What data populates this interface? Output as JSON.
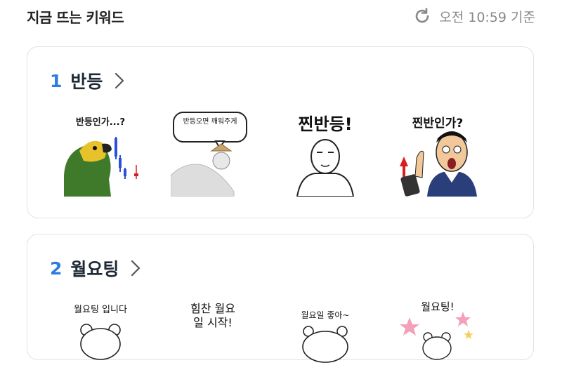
{
  "header": {
    "title": "지금 뜨는 키워드",
    "updated": "오전 10:59 기준",
    "refresh_icon": "refresh-icon"
  },
  "keywords": [
    {
      "rank": "1",
      "keyword": "반등",
      "stickers": [
        {
          "caption": "반등인가...?"
        },
        {
          "caption": "반등오면 깨워주게"
        },
        {
          "caption": "찐반등!"
        },
        {
          "caption": "찐반인가?"
        }
      ]
    },
    {
      "rank": "2",
      "keyword": "월요팅",
      "stickers": [
        {
          "caption": "월요팅 입니다"
        },
        {
          "caption": "힘찬 월요일 시작!"
        },
        {
          "caption": "월요일 좋아~"
        },
        {
          "caption": "월요팅!"
        }
      ]
    }
  ],
  "colors": {
    "accent": "#2f7be0",
    "text": "#1f2a36",
    "muted": "#888888"
  }
}
